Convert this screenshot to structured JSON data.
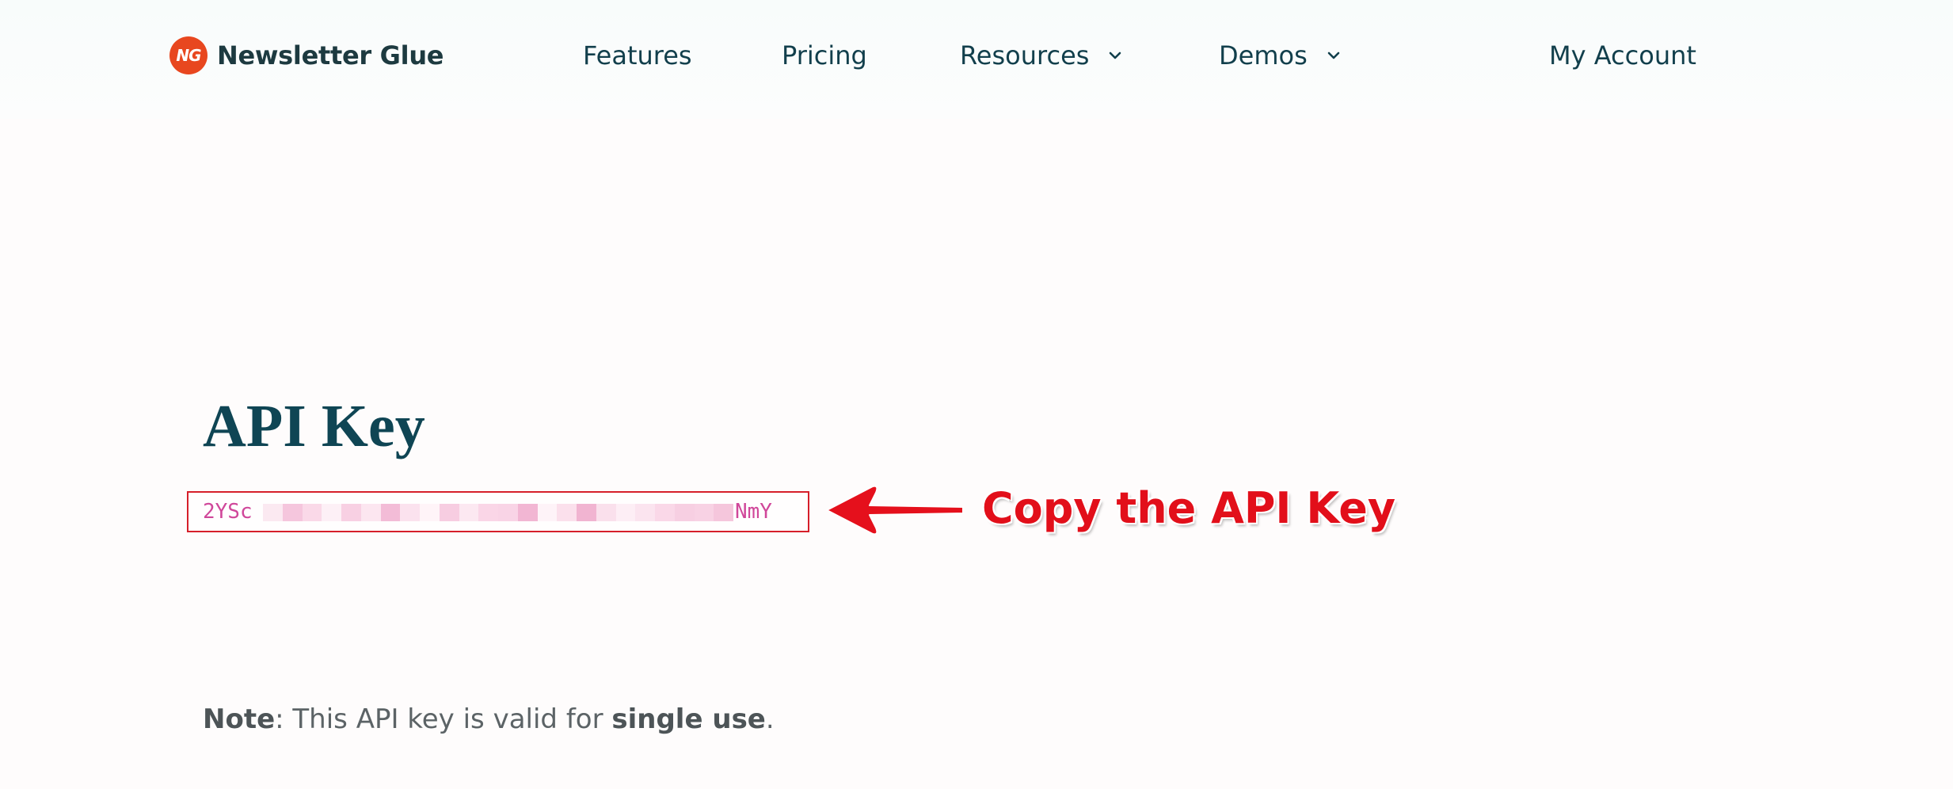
{
  "header": {
    "logo_badge": "NG",
    "brand": "Newsletter Glue",
    "nav": {
      "features": "Features",
      "pricing": "Pricing",
      "resources": "Resources",
      "demos": "Demos",
      "account": "My Account"
    }
  },
  "main": {
    "title": "API Key",
    "api_key_start": "2YSc",
    "api_key_end": "NmY",
    "annotation": "Copy the API Key",
    "note": {
      "label": "Note",
      "text_before": ": This API key is valid for ",
      "emphasis": "single use",
      "text_after": "."
    }
  },
  "colors": {
    "brand_orange": "#e8471f",
    "heading": "#0f4554",
    "annotation_red": "#e20f1a",
    "key_text": "#d0479a"
  },
  "icons": {
    "logo": "ng-logo-icon",
    "dropdown": "chevron-down-icon",
    "arrow": "arrow-left-icon"
  }
}
